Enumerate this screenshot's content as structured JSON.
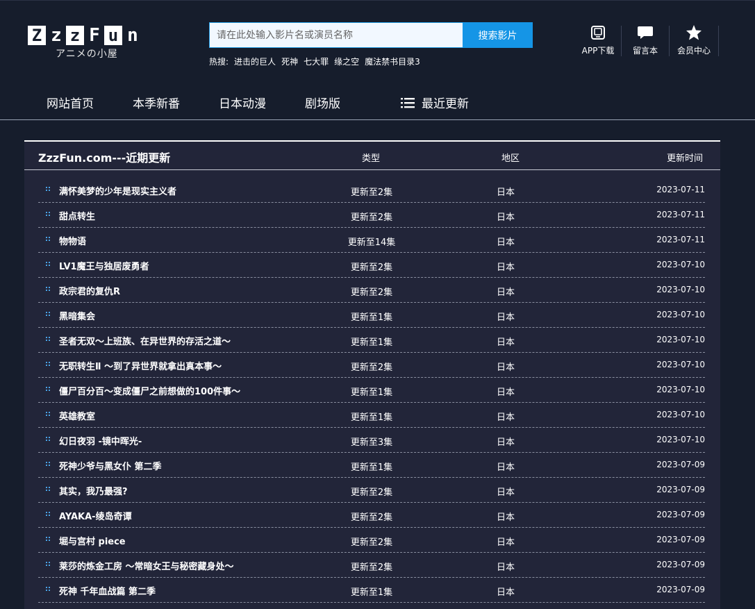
{
  "logo": {
    "letters": [
      "Z",
      "z",
      "z",
      "F",
      "u",
      "n"
    ],
    "subtitle": "アニメの小屋"
  },
  "search": {
    "placeholder": "请在此处输入影片名或演员名称",
    "button_label": "搜索影片",
    "hot_label": "热搜:",
    "hot_terms": [
      "进击的巨人",
      "死神",
      "七大罪",
      "缘之空",
      "魔法禁书目录3"
    ]
  },
  "tools": [
    {
      "label": "APP下载",
      "icon": "app-icon"
    },
    {
      "label": "留言本",
      "icon": "chat-icon"
    },
    {
      "label": "会员中心",
      "icon": "star-icon"
    }
  ],
  "nav": {
    "items": [
      "网站首页",
      "本季新番",
      "日本动漫",
      "剧场版",
      "最近更新"
    ]
  },
  "panel": {
    "title": "ZzzFun.com---近期更新",
    "col_type": "类型",
    "col_region": "地区",
    "col_date": "更新时间"
  },
  "rows": [
    {
      "title": "满怀美梦的少年是现实主义者",
      "type": "更新至2集",
      "region": "日本",
      "date": "2023-07-11"
    },
    {
      "title": "甜点转生",
      "type": "更新至2集",
      "region": "日本",
      "date": "2023-07-11"
    },
    {
      "title": "物物语",
      "type": "更新至14集",
      "region": "日本",
      "date": "2023-07-11"
    },
    {
      "title": "LV1魔王与独居废勇者",
      "type": "更新至2集",
      "region": "日本",
      "date": "2023-07-10"
    },
    {
      "title": "政宗君的复仇R",
      "type": "更新至2集",
      "region": "日本",
      "date": "2023-07-10"
    },
    {
      "title": "黑暗集会",
      "type": "更新至1集",
      "region": "日本",
      "date": "2023-07-10"
    },
    {
      "title": "圣者无双～上班族、在异世界的存活之道～",
      "type": "更新至1集",
      "region": "日本",
      "date": "2023-07-10"
    },
    {
      "title": "无职转生Ⅱ ～到了异世界就拿出真本事～",
      "type": "更新至2集",
      "region": "日本",
      "date": "2023-07-10"
    },
    {
      "title": "僵尸百分百～变成僵尸之前想做的100件事～",
      "type": "更新至1集",
      "region": "日本",
      "date": "2023-07-10"
    },
    {
      "title": "英雄教室",
      "type": "更新至1集",
      "region": "日本",
      "date": "2023-07-10"
    },
    {
      "title": "幻日夜羽 -镜中晖光-",
      "type": "更新至3集",
      "region": "日本",
      "date": "2023-07-10"
    },
    {
      "title": "死神少爷与黑女仆 第二季",
      "type": "更新至1集",
      "region": "日本",
      "date": "2023-07-09"
    },
    {
      "title": "其实，我乃最强?",
      "type": "更新至2集",
      "region": "日本",
      "date": "2023-07-09"
    },
    {
      "title": "AYAKA-绫岛奇谭",
      "type": "更新至2集",
      "region": "日本",
      "date": "2023-07-09"
    },
    {
      "title": "堀与宫村 piece",
      "type": "更新至2集",
      "region": "日本",
      "date": "2023-07-09"
    },
    {
      "title": "莱莎的炼金工房 ～常暗女王与秘密藏身处～",
      "type": "更新至2集",
      "region": "日本",
      "date": "2023-07-09"
    },
    {
      "title": "死神 千年血战篇 第二季",
      "type": "更新至1集",
      "region": "日本",
      "date": "2023-07-09"
    }
  ],
  "colors": {
    "background": "#161d2c",
    "panel": "#222539",
    "accent": "#1595e6",
    "bullet": "#4aa3e8"
  }
}
